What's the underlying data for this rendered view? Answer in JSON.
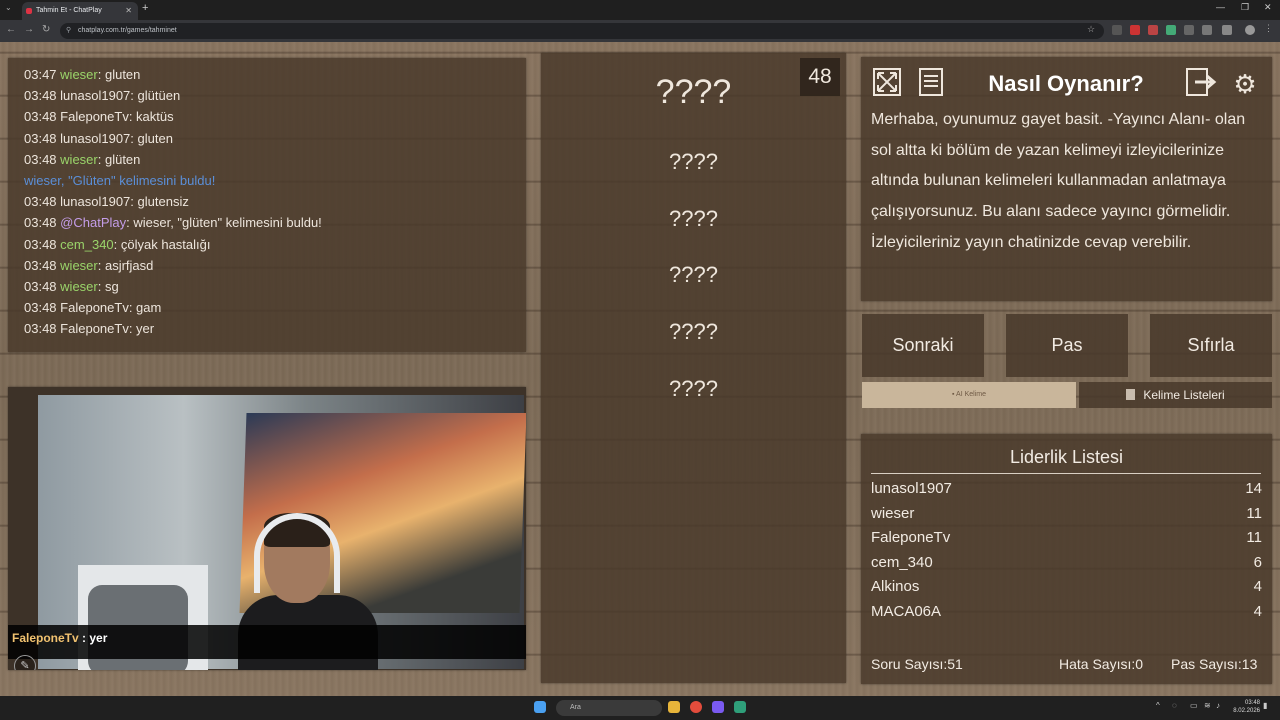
{
  "browser": {
    "tab_title": "Tahmin Et - ChatPlay",
    "url": "chatplay.com.tr/games/tahminet"
  },
  "chat": {
    "lines": [
      {
        "time": "03:47",
        "user": "wieser",
        "text": ": gluten",
        "color": "green"
      },
      {
        "time": "03:48",
        "user": "lunasol1907",
        "text": ": glütüen",
        "color": "plain"
      },
      {
        "time": "03:48",
        "user": "FaleponeTv",
        "text": ": kaktüs",
        "color": "plain"
      },
      {
        "time": "03:48",
        "user": "lunasol1907",
        "text": ": gluten",
        "color": "plain"
      },
      {
        "time": "03:48",
        "user": "wieser",
        "text": ": glüten",
        "color": "green"
      },
      {
        "time": "",
        "user": "",
        "text": "wieser, \"Glüten\" kelimesini buldu!",
        "color": "system"
      },
      {
        "time": "03:48",
        "user": "lunasol1907",
        "text": ": glutensiz",
        "color": "plain"
      },
      {
        "time": "03:48",
        "user": "@ChatPlay",
        "text": ": wieser, \"glüten\" kelimesini buldu!",
        "color": "purple"
      },
      {
        "time": "03:48",
        "user": "cem_340",
        "text": ": çölyak hastalığı",
        "color": "green"
      },
      {
        "time": "03:48",
        "user": "wieser",
        "text": ": asjrfjasd",
        "color": "green"
      },
      {
        "time": "03:48",
        "user": "wieser",
        "text": ": sg",
        "color": "green"
      },
      {
        "time": "03:48",
        "user": "FaleponeTv",
        "text": ": gam",
        "color": "plain"
      },
      {
        "time": "03:48",
        "user": "FaleponeTv",
        "text": ": yer",
        "color": "plain"
      }
    ]
  },
  "webcam": {
    "caption_user": "FaleponeTv",
    "caption_text": " : yer"
  },
  "game": {
    "main_word": "????",
    "forbidden_words": [
      "????",
      "????",
      "????",
      "????",
      "????"
    ],
    "timer": "48"
  },
  "info": {
    "title": "Nasıl Oynanır?",
    "text": "Merhaba, oyunumuz gayet basit. -Yayıncı Alanı- olan sol altta ki bölüm de yazan kelimeyi izleyicilerinize altında bulunan kelimeleri kullanmadan anlatmaya çalışıyorsunuz. Bu alanı sadece yayıncı görmelidir. İzleyicileriniz yayın chatinizde cevap verebilir."
  },
  "buttons": {
    "next": "Sonraki",
    "pass": "Pas",
    "reset": "Sıfırla",
    "ai_word": "AI Kelime",
    "word_lists": "Kelime Listeleri"
  },
  "leaderboard": {
    "title": "Liderlik Listesi",
    "rows": [
      {
        "name": "lunasol1907",
        "score": "14"
      },
      {
        "name": "wieser",
        "score": "11"
      },
      {
        "name": "FaleponeTv",
        "score": "11"
      },
      {
        "name": "cem_340",
        "score": "6"
      },
      {
        "name": "Alkinos",
        "score": "4"
      },
      {
        "name": "MACA06A",
        "score": "4"
      }
    ],
    "question_count": "Soru Sayısı:51",
    "error_count": "Hata Sayısı:0",
    "pass_count": "Pas Sayısı:13"
  },
  "taskbar": {
    "search_placeholder": "Ara",
    "time": "03:48",
    "date": "8.02.2026"
  }
}
